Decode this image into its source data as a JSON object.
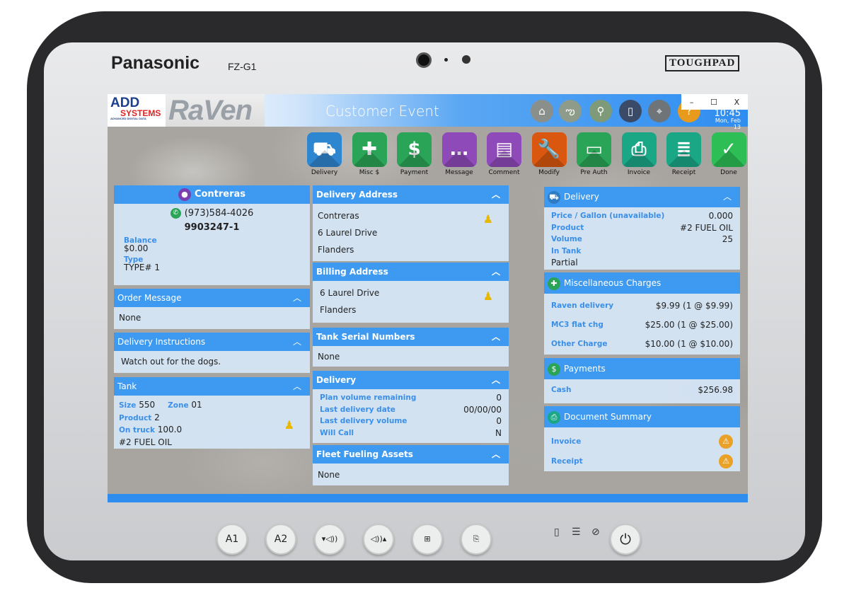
{
  "device": {
    "brand": "Panasonic",
    "model": "FZ-G1",
    "badge": "TOUGHPAD"
  },
  "app": {
    "logo_add": "ADD",
    "logo_systems": "SYSTEMS",
    "logo_tagline": "ADVANCED DIGITAL DATA",
    "logo_raven": "RaVen",
    "title": "Customer Event",
    "time": "10:45",
    "date": "Mon, Feb 13",
    "top_icons": [
      {
        "icon": "home-icon",
        "color": "#8a8f8c"
      },
      {
        "icon": "route-icon",
        "color": "#8e9a8a"
      },
      {
        "icon": "map-pin-icon",
        "color": "#7f9a78"
      },
      {
        "icon": "phone-icon",
        "color": "#3b4a66"
      },
      {
        "icon": "gps-icon",
        "color": "#6f7478"
      },
      {
        "icon": "help-icon",
        "color": "#e89a1c"
      }
    ],
    "window_controls": {
      "minimize": "–",
      "maximize": "☐",
      "close": "X"
    }
  },
  "toolbar": [
    {
      "label": "Delivery",
      "icon": "truck-icon",
      "glyph": "⛟",
      "color": "#2f86d0"
    },
    {
      "label": "Misc $",
      "icon": "plus-icon",
      "glyph": "✚",
      "color": "#2aa457"
    },
    {
      "label": "Payment",
      "icon": "dollar-icon",
      "glyph": "$",
      "color": "#2aa457"
    },
    {
      "label": "Message",
      "icon": "message-icon",
      "glyph": "…",
      "color": "#8e4ab8"
    },
    {
      "label": "Comment",
      "icon": "comment-icon",
      "glyph": "▤",
      "color": "#8e4ab8"
    },
    {
      "label": "Modify",
      "icon": "wrench-icon",
      "glyph": "🔧",
      "color": "#d9570f"
    },
    {
      "label": "Pre Auth",
      "icon": "certificate-icon",
      "glyph": "▭",
      "color": "#2aa457"
    },
    {
      "label": "Invoice",
      "icon": "printer-icon",
      "glyph": "⎙",
      "color": "#1aa785"
    },
    {
      "label": "Receipt",
      "icon": "receipt-icon",
      "glyph": "≣",
      "color": "#1aa785"
    },
    {
      "label": "Done",
      "icon": "check-icon",
      "glyph": "✓",
      "color": "#2dbe55"
    }
  ],
  "customer": {
    "name": "Contreras",
    "phone": "(973)584-4026",
    "account": "9903247-1",
    "balance_label": "Balance",
    "balance": "$0.00",
    "type_label": "Type",
    "type": "TYPE# 1"
  },
  "order_message": {
    "title": "Order Message",
    "value": "None"
  },
  "delivery_instructions": {
    "title": "Delivery Instructions",
    "value": "Watch out for the dogs."
  },
  "tank": {
    "title": "Tank",
    "size_label": "Size",
    "size": "550",
    "zone_label": "Zone",
    "zone": "01",
    "product_label": "Product",
    "product": "2",
    "on_truck_label": "On truck",
    "on_truck": "100.0",
    "product_name": "#2 FUEL OIL"
  },
  "delivery_address": {
    "title": "Delivery Address",
    "lines": [
      "Contreras",
      "6 Laurel Drive",
      "Flanders"
    ]
  },
  "billing_address": {
    "title": "Billing Address",
    "lines": [
      "6 Laurel Drive",
      "Flanders"
    ]
  },
  "tank_serial": {
    "title": "Tank Serial Numbers",
    "value": "None"
  },
  "delivery_info": {
    "title": "Delivery",
    "rows": [
      {
        "label": "Plan volume remaining",
        "value": "0"
      },
      {
        "label": "Last delivery date",
        "value": "00/00/00"
      },
      {
        "label": "Last delivery volume",
        "value": "0"
      },
      {
        "label": "Will Call",
        "value": "N"
      }
    ]
  },
  "fleet": {
    "title": "Fleet Fueling Assets",
    "value": "None"
  },
  "delivery_summary": {
    "title": "Delivery",
    "rows": [
      {
        "label": "Price / Gallon (unavailable)",
        "value": "0.000"
      },
      {
        "label": "Product",
        "value": "#2 FUEL OIL"
      },
      {
        "label": "Volume",
        "value": "25"
      }
    ],
    "in_tank_label": "In Tank",
    "in_tank": "Partial"
  },
  "misc_charges": {
    "title": "Miscellaneous Charges",
    "rows": [
      {
        "label": "Raven delivery",
        "value": "$9.99 (1 @ $9.99)"
      },
      {
        "label": "MC3 flat chg",
        "value": "$25.00 (1 @ $25.00)"
      },
      {
        "label": "Other Charge",
        "value": "$10.00 (1 @ $10.00)"
      }
    ]
  },
  "payments": {
    "title": "Payments",
    "rows": [
      {
        "label": "Cash",
        "value": "$256.98"
      }
    ]
  },
  "documents": {
    "title": "Document Summary",
    "rows": [
      {
        "label": "Invoice",
        "status": "warning"
      },
      {
        "label": "Receipt",
        "status": "warning"
      }
    ]
  },
  "hardware_buttons": [
    "A1",
    "A2",
    "▾◁))",
    "◁))▴",
    "⊞",
    "⎘"
  ]
}
